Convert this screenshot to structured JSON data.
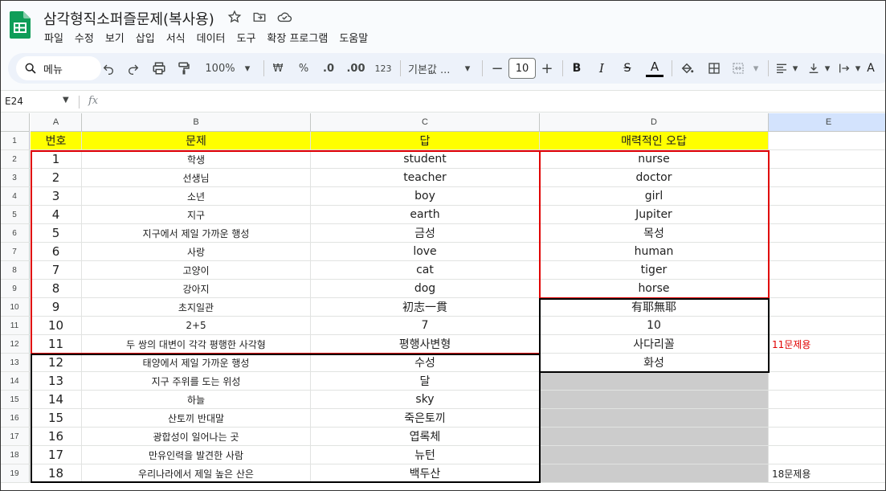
{
  "doc": {
    "title": "삼각형직소퍼즐문제(복사용)",
    "menu": [
      "파일",
      "수정",
      "보기",
      "삽입",
      "서식",
      "데이터",
      "도구",
      "확장 프로그램",
      "도움말"
    ]
  },
  "toolbar": {
    "search_label": "메뉴",
    "zoom": "100%",
    "currency": "₩",
    "percent": "%",
    "decimal_decrease": ".0",
    "decimal_increase": ".00",
    "number_format": "123",
    "font_name": "기본값 ...",
    "font_size": "10",
    "bold": "B",
    "italic": "I",
    "strike": "S",
    "text_color": "A",
    "more_a": "A"
  },
  "formula_bar": {
    "cell_ref": "E24",
    "fx": "fx"
  },
  "columns": [
    "A",
    "B",
    "C",
    "D",
    "E"
  ],
  "header_row": {
    "row": "1",
    "a": "번호",
    "b": "문제",
    "c": "답",
    "d": "매력적인 오답"
  },
  "rows": [
    {
      "row": "2",
      "a": "1",
      "b": "학생",
      "c": "student",
      "d": "nurse",
      "e": ""
    },
    {
      "row": "3",
      "a": "2",
      "b": "선생님",
      "c": "teacher",
      "d": "doctor",
      "e": ""
    },
    {
      "row": "4",
      "a": "3",
      "b": "소년",
      "c": "boy",
      "d": "girl",
      "e": ""
    },
    {
      "row": "5",
      "a": "4",
      "b": "지구",
      "c": "earth",
      "d": "Jupiter",
      "e": ""
    },
    {
      "row": "6",
      "a": "5",
      "b": "지구에서 제일 가까운 행성",
      "c": "금성",
      "d": "목성",
      "e": ""
    },
    {
      "row": "7",
      "a": "6",
      "b": "사랑",
      "c": "love",
      "d": "human",
      "e": ""
    },
    {
      "row": "8",
      "a": "7",
      "b": "고양이",
      "c": "cat",
      "d": "tiger",
      "e": ""
    },
    {
      "row": "9",
      "a": "8",
      "b": "강아지",
      "c": "dog",
      "d": "horse",
      "e": ""
    },
    {
      "row": "10",
      "a": "9",
      "b": "초지일관",
      "c": "初志一貫",
      "d": "有耶無耶",
      "e": ""
    },
    {
      "row": "11",
      "a": "10",
      "b": "2+5",
      "c": "7",
      "d": "10",
      "e": ""
    },
    {
      "row": "12",
      "a": "11",
      "b": "두 쌍의 대변이 각각 평행한 사각형",
      "c": "평행사변형",
      "d": "사다리꼴",
      "e": "11문제용"
    },
    {
      "row": "13",
      "a": "12",
      "b": "태양에서 제일 가까운 행성",
      "c": "수성",
      "d": "화성",
      "e": ""
    },
    {
      "row": "14",
      "a": "13",
      "b": "지구 주위를 도는 위성",
      "c": "달",
      "d": "",
      "e": ""
    },
    {
      "row": "15",
      "a": "14",
      "b": "하늘",
      "c": "sky",
      "d": "",
      "e": ""
    },
    {
      "row": "16",
      "a": "15",
      "b": "산토끼 반대말",
      "c": "죽은토끼",
      "d": "",
      "e": ""
    },
    {
      "row": "17",
      "a": "16",
      "b": "광합성이 일어나는 곳",
      "c": "엽록체",
      "d": "",
      "e": ""
    },
    {
      "row": "18",
      "a": "17",
      "b": "만유인력을 발견한 사람",
      "c": "뉴턴",
      "d": "",
      "e": ""
    },
    {
      "row": "19",
      "a": "18",
      "b": "우리나라에서 제일 높은 산은",
      "c": "백두산",
      "d": "",
      "e": "18문제용"
    }
  ],
  "colors": {
    "header_fill": "#ffff00",
    "gray_fill": "#cccccc",
    "red_border": "#e00000",
    "note_red": "#e00000",
    "selected_col": "#d3e3fd"
  },
  "icons": [
    "sheets-logo-icon",
    "star-icon",
    "move-folder-icon",
    "cloud-saved-icon",
    "search-icon",
    "undo-icon",
    "redo-icon",
    "print-icon",
    "paint-format-icon",
    "caret-down-icon",
    "minus-icon",
    "plus-icon",
    "fill-color-icon",
    "borders-icon",
    "merge-cells-icon",
    "align-left-icon",
    "valign-bottom-icon",
    "text-wrap-icon"
  ]
}
